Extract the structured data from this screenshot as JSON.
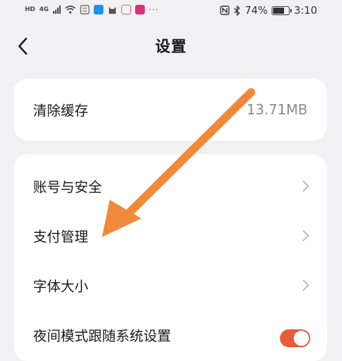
{
  "status_bar": {
    "network_badge": "HD",
    "signal_badge": "4G",
    "battery_percent": "74%",
    "time": "3:10",
    "battery_level": 0.74
  },
  "header": {
    "title": "设置"
  },
  "cache": {
    "label": "清除缓存",
    "value": "13.71MB"
  },
  "settings": {
    "items": [
      {
        "label": "账号与安全"
      },
      {
        "label": "支付管理"
      },
      {
        "label": "字体大小"
      },
      {
        "label": "夜间模式跟随系统设置"
      }
    ]
  },
  "colors": {
    "accent_toggle": "#ec5a3e",
    "annotation_arrow": "#f08a3a"
  }
}
